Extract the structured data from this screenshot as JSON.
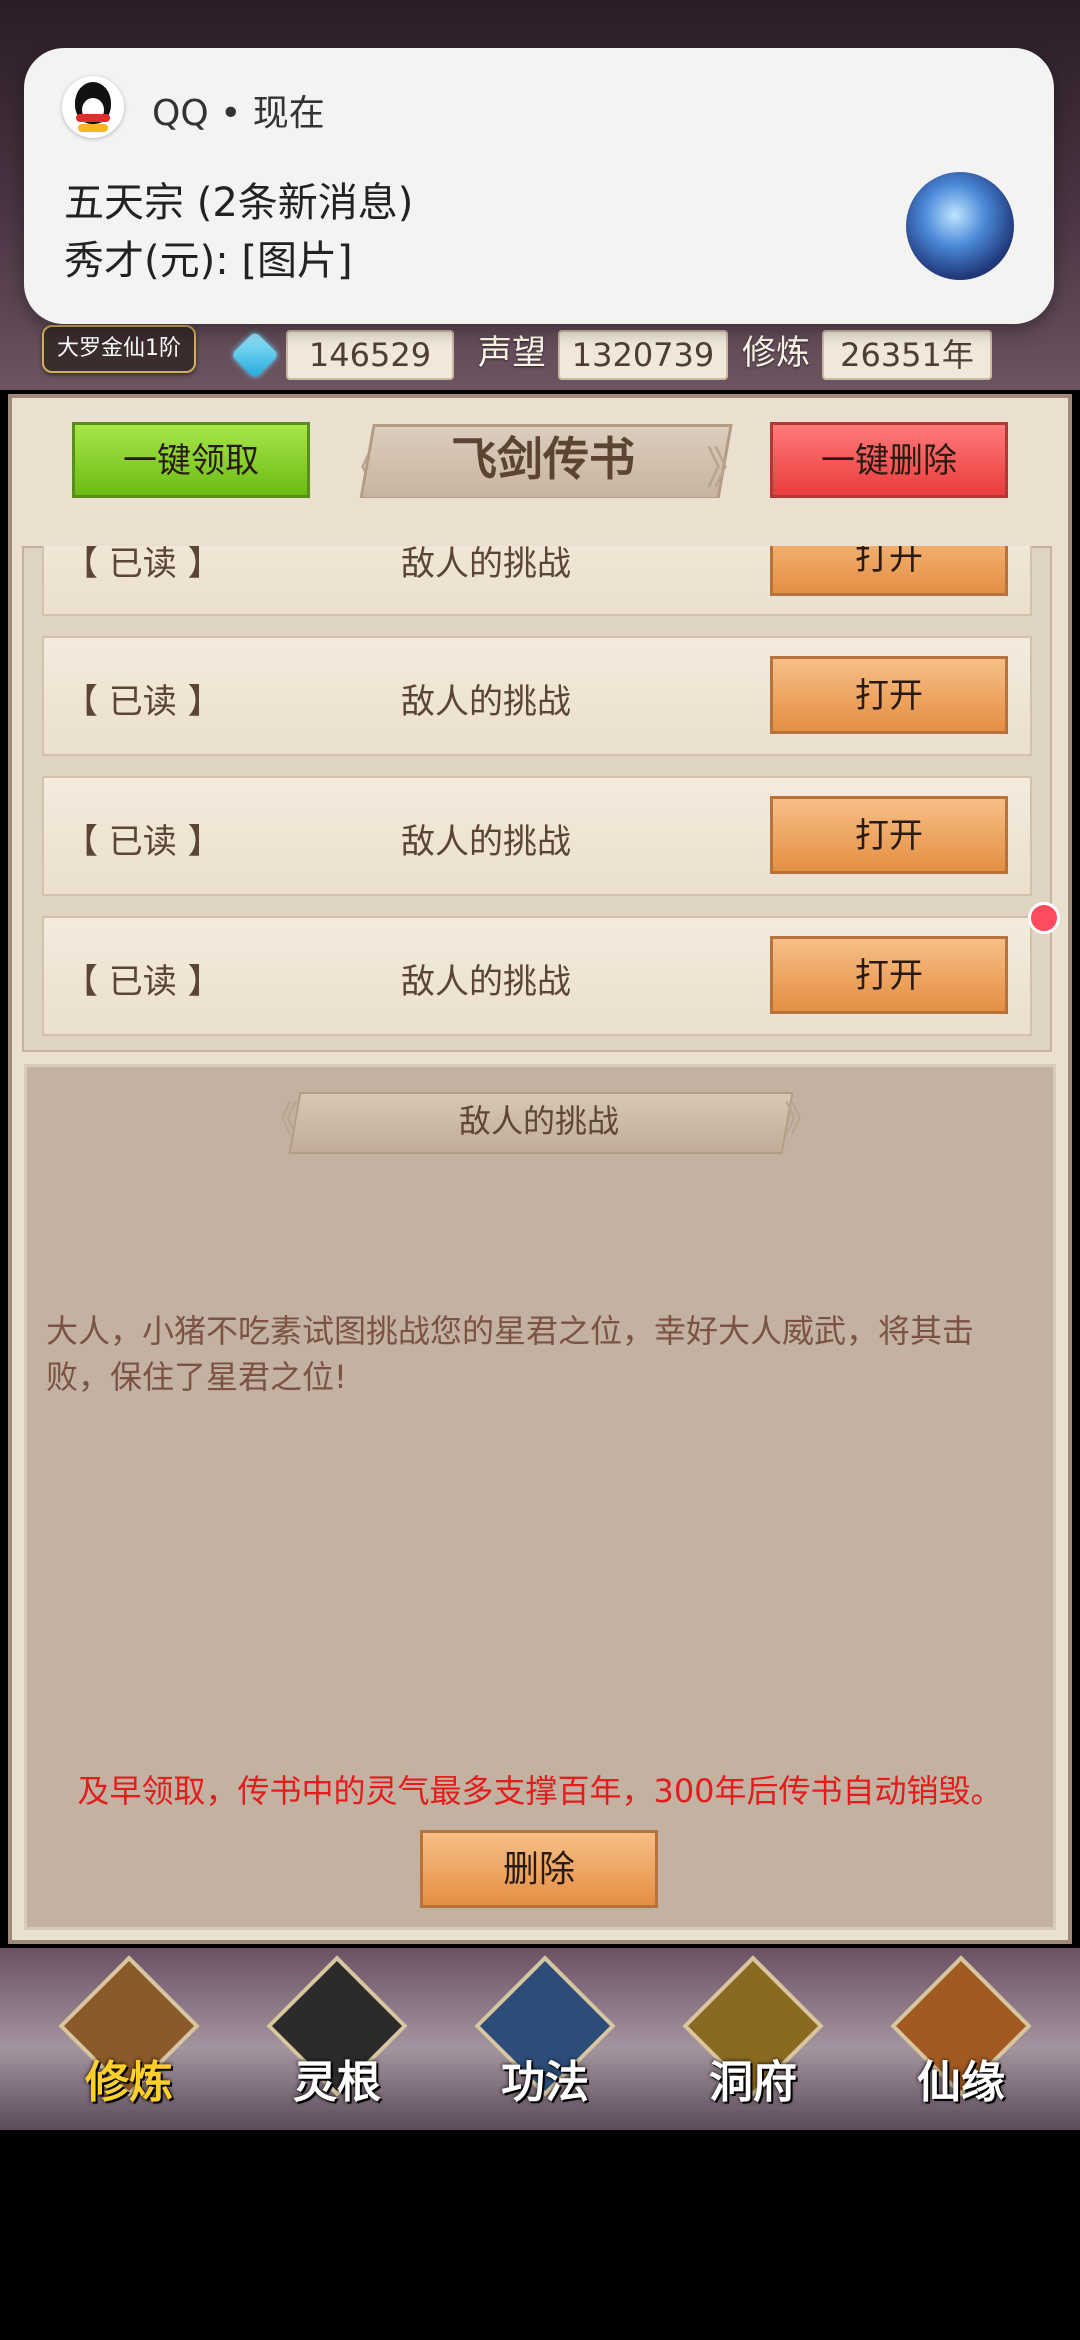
{
  "notification": {
    "app_name": "QQ • 现在",
    "title": "五天宗 (2条新消息)",
    "message": "秀才(元): [图片]"
  },
  "header": {
    "rank": "大罗金仙1阶",
    "gems": "146529",
    "reputation_label": "声望",
    "reputation": "1320739",
    "cultivation_label": "修炼",
    "cultivation": "26351年"
  },
  "panel": {
    "claim_all_label": "一键领取",
    "title": "飞剑传书",
    "delete_all_label": "一键删除"
  },
  "mail_list": [
    {
      "status": "【 已读 】",
      "subject": "敌人的挑战",
      "action": "打开"
    },
    {
      "status": "【 已读 】",
      "subject": "敌人的挑战",
      "action": "打开"
    },
    {
      "status": "【 已读 】",
      "subject": "敌人的挑战",
      "action": "打开"
    },
    {
      "status": "【 已读 】",
      "subject": "敌人的挑战",
      "action": "打开"
    }
  ],
  "detail": {
    "title": "敌人的挑战",
    "body": "大人，小猪不吃素试图挑战您的星君之位，幸好大人威武，将其击败，保住了星君之位!",
    "warning": "及早领取，传书中的灵气最多支撑百年，300年后传书自动销毁。",
    "delete_label": "删除"
  },
  "bottom_nav": [
    {
      "label": "修炼",
      "icon": "monk-icon",
      "active": true
    },
    {
      "label": "灵根",
      "icon": "taiji-sword-icon",
      "active": false
    },
    {
      "label": "功法",
      "icon": "book-icon",
      "active": false
    },
    {
      "label": "洞府",
      "icon": "pagoda-icon",
      "active": false
    },
    {
      "label": "仙缘",
      "icon": "gourd-icon",
      "active": false
    }
  ]
}
